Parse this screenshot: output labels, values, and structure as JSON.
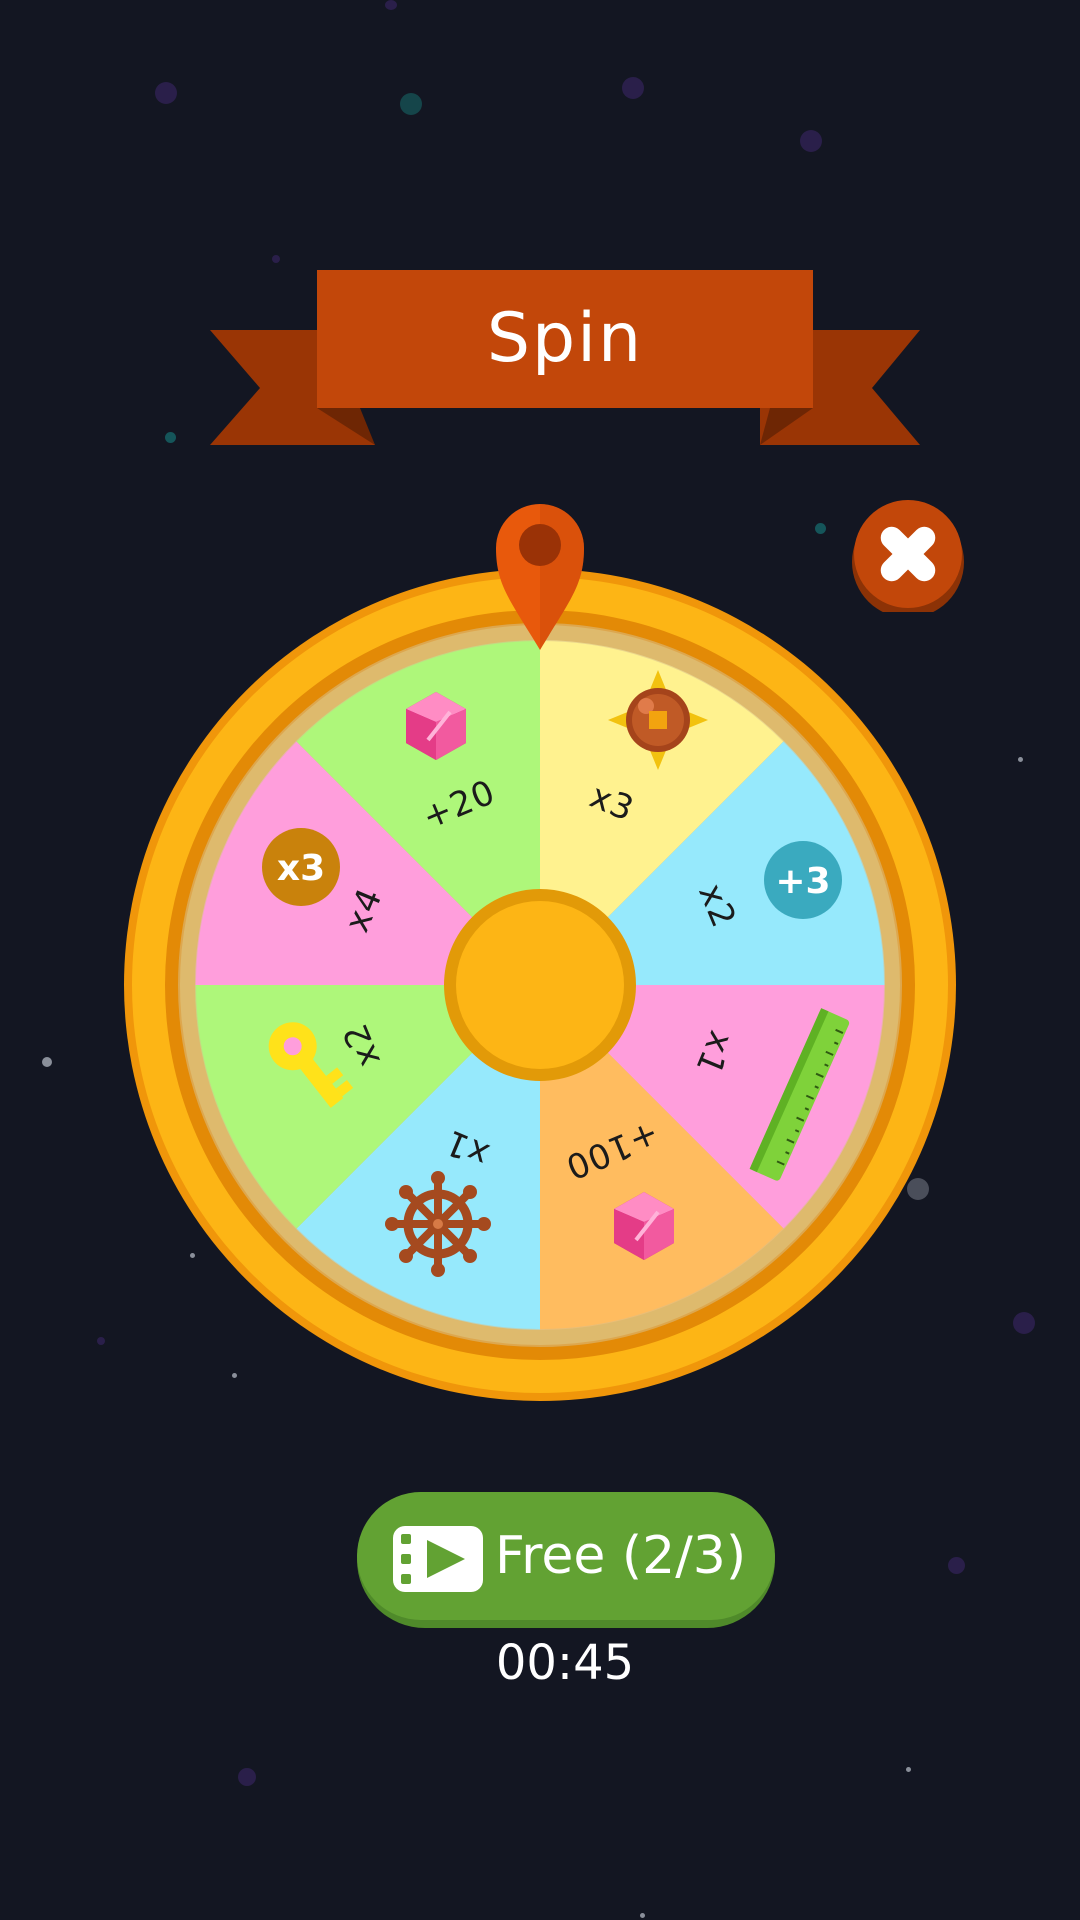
{
  "title": "Spin",
  "wheel": {
    "segments": [
      {
        "label": "+20",
        "color": "#fff28f",
        "icon": "gem-icon"
      },
      {
        "label": "x3",
        "color": "#96e9fc",
        "icon": "spiked-bomb-icon"
      },
      {
        "label": "x2",
        "color": "#ff9edc",
        "icon": "plus-three-badge-icon"
      },
      {
        "label": "x1",
        "color": "#ffbc5f",
        "icon": "ruler-icon"
      },
      {
        "label": "+100",
        "color": "#96e9fc",
        "icon": "gem-icon"
      },
      {
        "label": "x1",
        "color": "#aef77a",
        "icon": "ship-wheel-icon"
      },
      {
        "label": "x2",
        "color": "#ff9edc",
        "icon": "key-icon"
      },
      {
        "label": "x4",
        "color": "#aef77a",
        "icon": "x3-badge-icon"
      }
    ],
    "badges": {
      "x3": "x3",
      "plus3": "+3"
    },
    "rim_color": "#fdb515",
    "pointer_color": "#e8590c"
  },
  "free_button": {
    "label": "Free (2/3)",
    "icon": "video-ad-icon",
    "color": "#62a233"
  },
  "timer": "00:45",
  "close_button": {
    "icon": "close-icon",
    "color": "#c2470a"
  },
  "banner_color": "#c2470a"
}
